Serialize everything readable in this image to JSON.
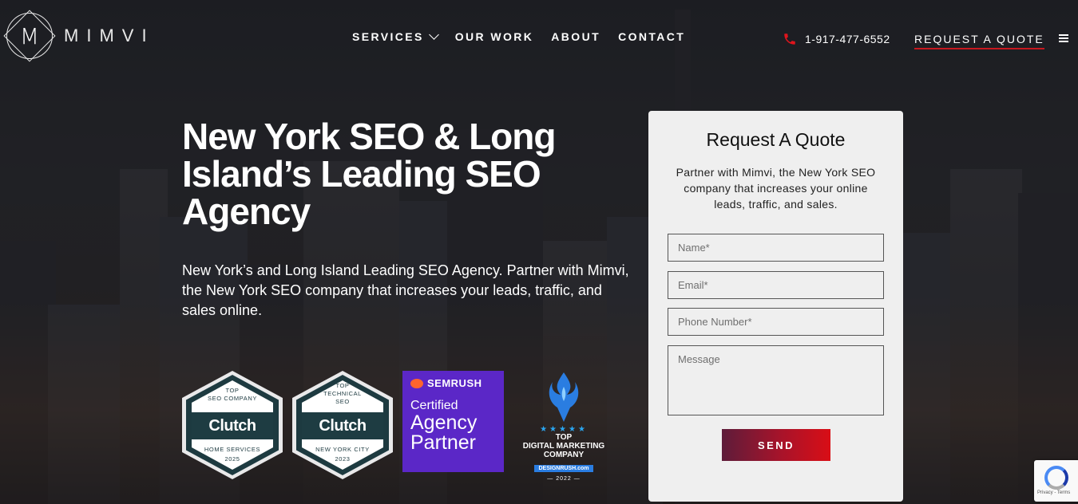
{
  "brand": {
    "logo_letter": "M",
    "name": "MIMVI"
  },
  "nav": {
    "items": [
      {
        "label": "SERVICES",
        "has_dropdown": true
      },
      {
        "label": "OUR WORK",
        "has_dropdown": false
      },
      {
        "label": "ABOUT",
        "has_dropdown": false
      },
      {
        "label": "CONTACT",
        "has_dropdown": false
      }
    ],
    "phone": "1-917-477-6552",
    "quote_link": "REQUEST A QUOTE"
  },
  "hero": {
    "title": "New York SEO & Long Island’s Leading SEO Agency",
    "subtitle": "New York’s and Long Island Leading SEO Agency. Partner with Mimvi, the New York SEO company that increases your leads, traffic, and sales online."
  },
  "badges": {
    "clutch1": {
      "top": "TOP\nSEO COMPANY",
      "brand": "Clutch",
      "bottom": "HOME SERVICES\n2025"
    },
    "clutch2": {
      "top": "TOP\nTECHNICAL\nSEO",
      "brand": "Clutch",
      "bottom": "NEW YORK CITY\n2023"
    },
    "semrush": {
      "brand": "SEMRUSH",
      "line1": "Certified",
      "line2": "Agency",
      "line3": "Partner"
    },
    "designrush": {
      "stars": "★★★★★",
      "top": "TOP",
      "line1": "DIGITAL MARKETING",
      "line2": "COMPANY",
      "site": "DESIGNRUSH.com",
      "year": "— 2022 —"
    }
  },
  "quote_form": {
    "title": "Request A Quote",
    "description": "Partner with Mimvi, the New York SEO company that increases your online leads, traffic, and sales.",
    "name_placeholder": "Name*",
    "email_placeholder": "Email*",
    "phone_placeholder": "Phone Number*",
    "message_placeholder": "Message",
    "send_label": "SEND"
  },
  "recaptcha": {
    "text": "Privacy - Terms"
  },
  "colors": {
    "accent_red": "#c8181f",
    "semrush_purple": "#5b27c7",
    "clutch_teal": "#1d3a40"
  }
}
